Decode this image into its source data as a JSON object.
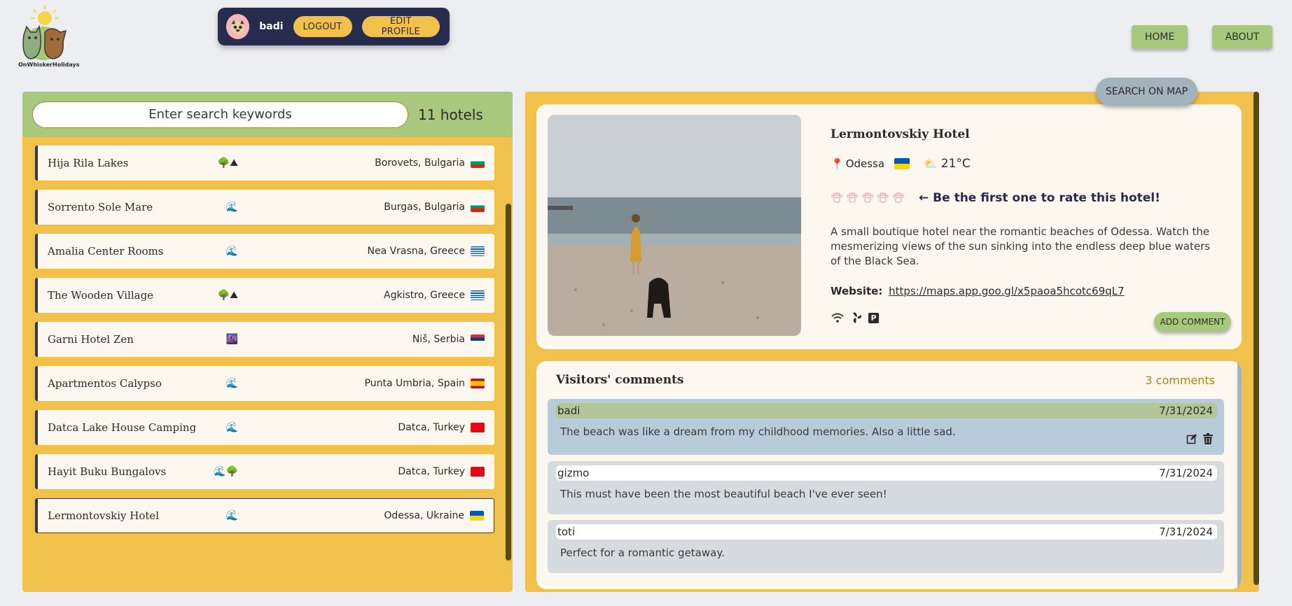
{
  "brand": {
    "name": "OnWhiskerHolidays"
  },
  "profile": {
    "username": "badi",
    "logout_label": "LOGOUT",
    "edit_label": "EDIT PROFILE"
  },
  "nav": {
    "home_label": "HOME",
    "about_label": "ABOUT"
  },
  "search": {
    "placeholder": "Enter search keywords",
    "count_label": "11 hotels"
  },
  "hotels": [
    {
      "name": "Hija Rila Lakes",
      "tags": "🌳⛰",
      "location": "Borovets, Bulgaria",
      "flag": "bulgaria"
    },
    {
      "name": "Sorrento Sole Mare",
      "tags": "🌊",
      "location": "Burgas, Bulgaria",
      "flag": "bulgaria"
    },
    {
      "name": "Amalia Center Rooms",
      "tags": "🌊",
      "location": "Nea Vrasna, Greece",
      "flag": "greece"
    },
    {
      "name": "The Wooden Village",
      "tags": "🌳⛰",
      "location": "Agkistro, Greece",
      "flag": "greece"
    },
    {
      "name": "Garni Hotel Zen",
      "tags": "🌆",
      "location": "Niš, Serbia",
      "flag": "serbia"
    },
    {
      "name": "Apartmentos Calypso",
      "tags": "🌊",
      "location": "Punta Umbria, Spain",
      "flag": "spain"
    },
    {
      "name": "Datca Lake House Camping",
      "tags": "🌊",
      "location": "Datca, Turkey",
      "flag": "turkey"
    },
    {
      "name": "Hayit Buku Bungalovs",
      "tags": "🌊🌳",
      "location": "Datca, Turkey",
      "flag": "turkey"
    },
    {
      "name": "Lermontovskiy Hotel",
      "tags": "🌊",
      "location": "Odessa, Ukraine",
      "flag": "ukraine"
    }
  ],
  "map_button": "SEARCH ON MAP",
  "detail": {
    "name": "Lermontovskiy Hotel",
    "city": "Odessa",
    "temperature": "21°C",
    "rate_prompt": "← Be the first one to rate this hotel!",
    "rating": 0,
    "description": "A small boutique hotel near the romantic beaches of Odessa. Watch the mesmerizing views of the sun sinking into the endless deep blue waters of the Black Sea.",
    "website_label": "Website:",
    "website_url": "https://maps.app.goo.gl/x5paoa5hcotc69qL7",
    "add_comment_label": "ADD COMMENT"
  },
  "comments": {
    "title": "Visitors' comments",
    "count_label": "3 comments",
    "items": [
      {
        "user": "badi",
        "date": "7/31/2024",
        "text": "The beach was like a dream from my childhood memories. Also a little sad."
      },
      {
        "user": "gizmo",
        "date": "7/31/2024",
        "text": "This must have been the most beautiful beach I've ever seen!"
      },
      {
        "user": "toti",
        "date": "7/31/2024",
        "text": "Perfect for a romantic getaway."
      }
    ]
  },
  "colors": {
    "panel_yellow": "#f2c14b",
    "green": "#a8c87e",
    "navy": "#272b4e",
    "cream": "#fcf7ef",
    "own_comment": "#b7cbd9",
    "other_comment": "#d5dbdf"
  }
}
